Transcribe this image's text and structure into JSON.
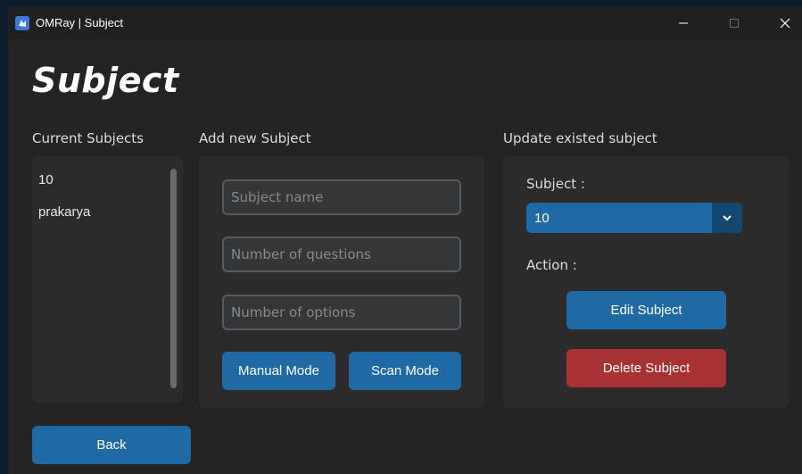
{
  "window": {
    "title": "OMRay | Subject"
  },
  "page": {
    "title": "Subject"
  },
  "current_subjects": {
    "label": "Current Subjects",
    "items": [
      "10",
      "prakarya"
    ]
  },
  "add_subject": {
    "label": "Add new Subject",
    "subject_name_placeholder": "Subject name",
    "questions_placeholder": "Number of questions",
    "options_placeholder": "Number of options",
    "manual_mode_label": "Manual Mode",
    "scan_mode_label": "Scan Mode"
  },
  "update_subject": {
    "label": "Update existed subject",
    "subject_label": "Subject :",
    "selected_subject": "10",
    "action_label": "Action :",
    "edit_label": "Edit Subject",
    "delete_label": "Delete Subject"
  },
  "footer": {
    "back_label": "Back"
  },
  "colors": {
    "window_bg": "#242424",
    "panel_bg": "#2b2b2b",
    "button_blue": "#1f6aa5",
    "button_red": "#a83232"
  },
  "icons": {
    "app": "omray-app-icon",
    "minimize": "minimize-icon",
    "maximize": "maximize-icon",
    "close": "close-icon",
    "dropdown": "chevron-down-icon"
  }
}
